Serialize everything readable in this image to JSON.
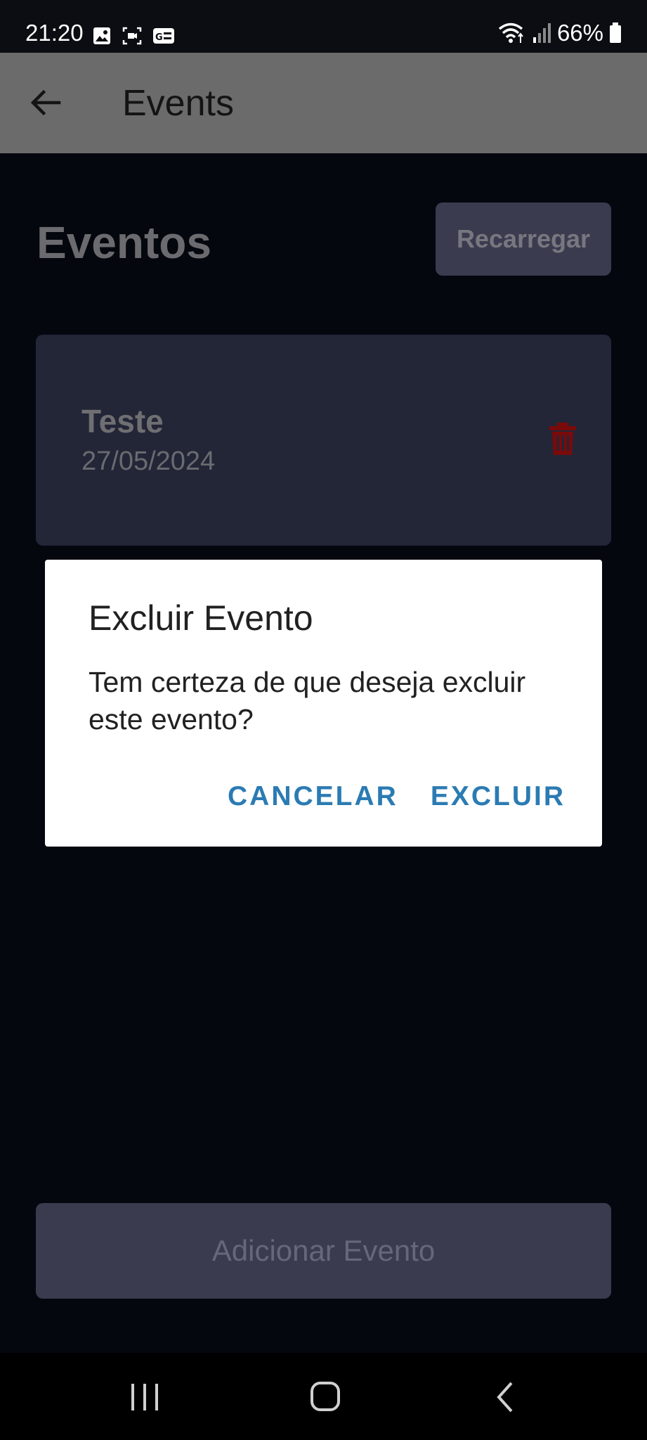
{
  "status_bar": {
    "time": "21:20",
    "battery_text": "66%",
    "left_icons": [
      "image-icon",
      "screen-record-icon",
      "gallery-icon"
    ],
    "right_icons": [
      "wifi-icon",
      "signal-icon",
      "battery-icon"
    ]
  },
  "app_bar": {
    "title": "Events",
    "back_icon": "arrow-left-icon"
  },
  "page": {
    "heading": "Eventos",
    "reload_label": "Recarregar",
    "add_label": "Adicionar Evento"
  },
  "events": [
    {
      "name": "Teste",
      "date": "27/05/2024",
      "delete_icon": "trash-icon"
    }
  ],
  "dialog": {
    "title": "Excluir Evento",
    "message": "Tem certeza de que deseja excluir este evento?",
    "cancel_label": "CANCELAR",
    "confirm_label": "EXCLUIR"
  },
  "nav_bar": {
    "icons": [
      "recent-apps-icon",
      "home-icon",
      "back-icon"
    ]
  },
  "colors": {
    "background": "#05070f",
    "card": "#232637",
    "button": "#3a3b4f",
    "dialog_action": "#2b7bb3",
    "delete": "#7a0a0a"
  }
}
